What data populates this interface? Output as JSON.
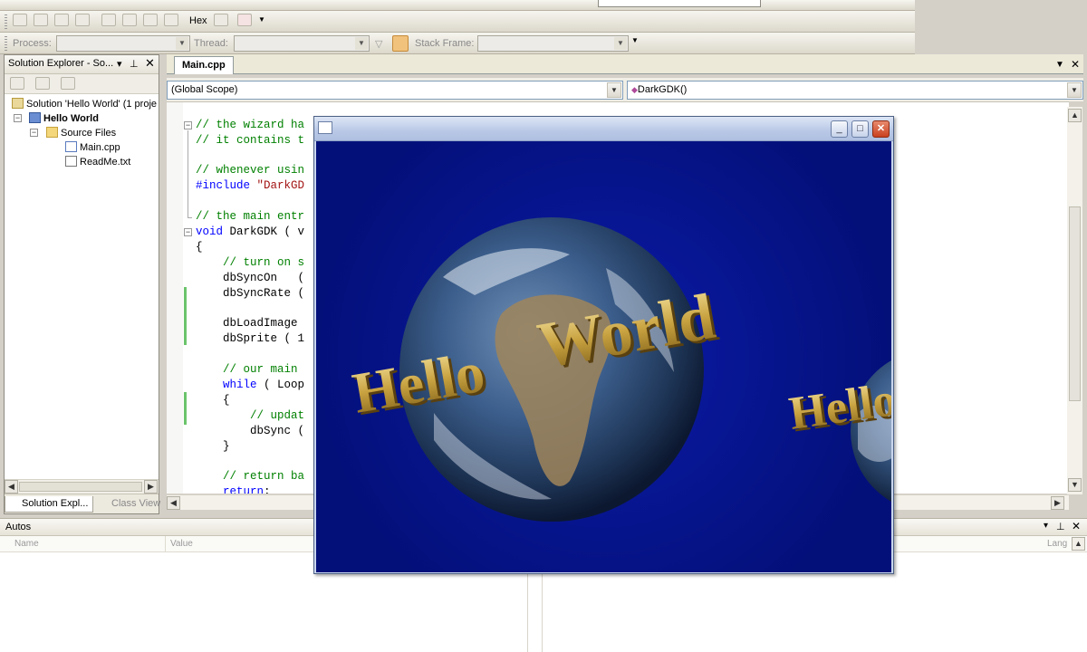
{
  "toolbar": {
    "hex_label": "Hex",
    "process_label": "Process:",
    "thread_label": "Thread:",
    "stack_frame_label": "Stack Frame:"
  },
  "solution_explorer": {
    "title": "Solution Explorer - So...",
    "tree": {
      "solution": "Solution 'Hello World' (1 proje",
      "project": "Hello World",
      "folder": "Source Files",
      "files": [
        "Main.cpp",
        "ReadMe.txt"
      ]
    },
    "tabs": [
      "Solution Expl...",
      "Class View"
    ]
  },
  "editor": {
    "tab": "Main.cpp",
    "scope": "(Global Scope)",
    "member": "DarkGDK()",
    "code": [
      {
        "text": "// the wizard ha",
        "style": "cmt"
      },
      {
        "text": "// it contains t",
        "style": "cmt"
      },
      {
        "text": "// whenever usin",
        "style": "cmt"
      },
      {
        "text": "#include \"DarkGD",
        "style": "inc"
      },
      {
        "text": "// the main entr",
        "style": "cmt"
      },
      {
        "text": "void DarkGDK ( v",
        "style": "void"
      },
      {
        "text": "{",
        "style": "plain"
      },
      {
        "text": "    // turn on s",
        "style": "cmt"
      },
      {
        "text": "    dbSyncOn   (",
        "style": "plain"
      },
      {
        "text": "    dbSyncRate (",
        "style": "plain"
      },
      {
        "text": "    dbLoadImage",
        "style": "plain"
      },
      {
        "text": "    dbSprite ( 1",
        "style": "plain"
      },
      {
        "text": "    // our main",
        "style": "cmt"
      },
      {
        "text": "    while ( Loop",
        "style": "while"
      },
      {
        "text": "    {",
        "style": "plain"
      },
      {
        "text": "        // updat",
        "style": "cmt"
      },
      {
        "text": "        dbSync (",
        "style": "plain"
      },
      {
        "text": "    }",
        "style": "plain"
      },
      {
        "text": "    // return ba",
        "style": "cmt"
      },
      {
        "text": "    return;",
        "style": "return"
      }
    ]
  },
  "autos": {
    "title": "Autos",
    "columns": [
      "Name",
      "Value",
      "Lang"
    ]
  },
  "game": {
    "words": [
      "Hello",
      "World",
      "Hello"
    ]
  }
}
